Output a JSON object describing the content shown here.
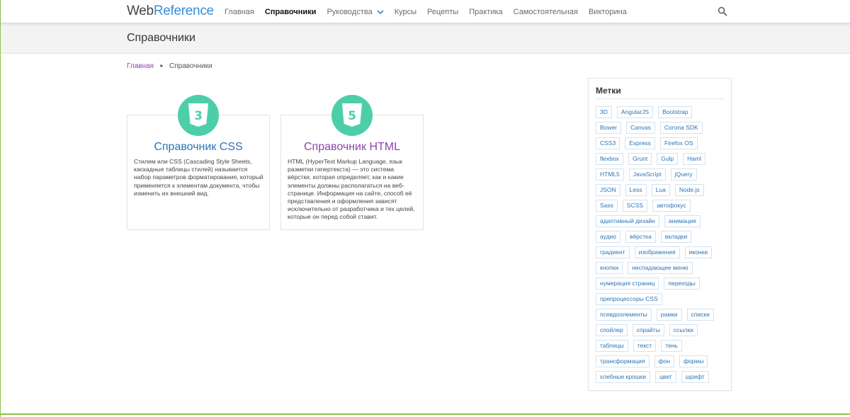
{
  "header": {
    "logo": {
      "part1": "Web",
      "part2": "Reference"
    },
    "nav": [
      {
        "label": "Главная",
        "active": false
      },
      {
        "label": "Справочники",
        "active": true
      },
      {
        "label": "Руководства",
        "active": false,
        "dropdown": true
      },
      {
        "label": "Курсы",
        "active": false
      },
      {
        "label": "Рецепты",
        "active": false
      },
      {
        "label": "Практика",
        "active": false
      },
      {
        "label": "Самостоятельная",
        "active": false
      },
      {
        "label": "Викторина",
        "active": false
      }
    ],
    "search_icon": "search-icon"
  },
  "page": {
    "title": "Справочники"
  },
  "breadcrumb": {
    "home": "Главная",
    "separator": "►",
    "current": "Справочники"
  },
  "cards": [
    {
      "icon": "css3-icon",
      "badge": "3",
      "title": "Справочник CSS",
      "title_color": "#2d74b5",
      "text": "Стилем или CSS (Cascading Style Sheets, каскадные таблицы стилей) называется набор параметров форматирования, который применяется к элементам документа, чтобы изменить их внешний вид."
    },
    {
      "icon": "html5-icon",
      "badge": "5",
      "title": "Справочник HTML",
      "title_color": "#8e44ad",
      "text": "HTML (HyperText Markup Language, язык разметки гипертекста) — это система вёрстки, которая определяет, как и какие элементы должны располагаться на веб-странице. Информация на сайте, способ её представления и оформления зависят исключительно от разработчика и тех целей, которые он перед собой ставит."
    }
  ],
  "sidebar": {
    "title": "Метки",
    "tag_rows": [
      [
        "3D",
        "AngularJS",
        "Bootstrap"
      ],
      [
        "Bower",
        "Canvas",
        "Corona SDK"
      ],
      [
        "CSS3",
        "Express",
        "Firefox OS"
      ],
      [
        "flexbox",
        "Grunt",
        "Gulp",
        "Haml"
      ],
      [
        "HTML5",
        "JavaScript",
        "jQuery"
      ],
      [
        "JSON",
        "Less",
        "Lua",
        "Node.js"
      ],
      [
        "Sass",
        "SCSS",
        "автофокус"
      ],
      [
        "адаптивный дизайн",
        "анимация"
      ],
      [
        "аудио",
        "вёрстка",
        "вкладки"
      ],
      [
        "градиент",
        "изображения",
        "иконки"
      ],
      [
        "кнопки",
        "ниспадающее меню"
      ],
      [
        "нумерация страниц",
        "переходы"
      ],
      [
        "препроцессоры CSS"
      ],
      [
        "псевдоэлементы",
        "рамки",
        "списки"
      ],
      [
        "спойлер",
        "спрайты",
        "ссылки"
      ],
      [
        "таблицы",
        "текст",
        "тень"
      ],
      [
        "трансформация",
        "фон",
        "формы"
      ],
      [
        "хлебные крошки",
        "цвет",
        "шрифт"
      ]
    ]
  },
  "colors": {
    "accent_blue": "#2d74b5",
    "accent_purple": "#8e44ad",
    "icon_teal": "#4ccfa9",
    "frame_green": "#8bc34a"
  }
}
